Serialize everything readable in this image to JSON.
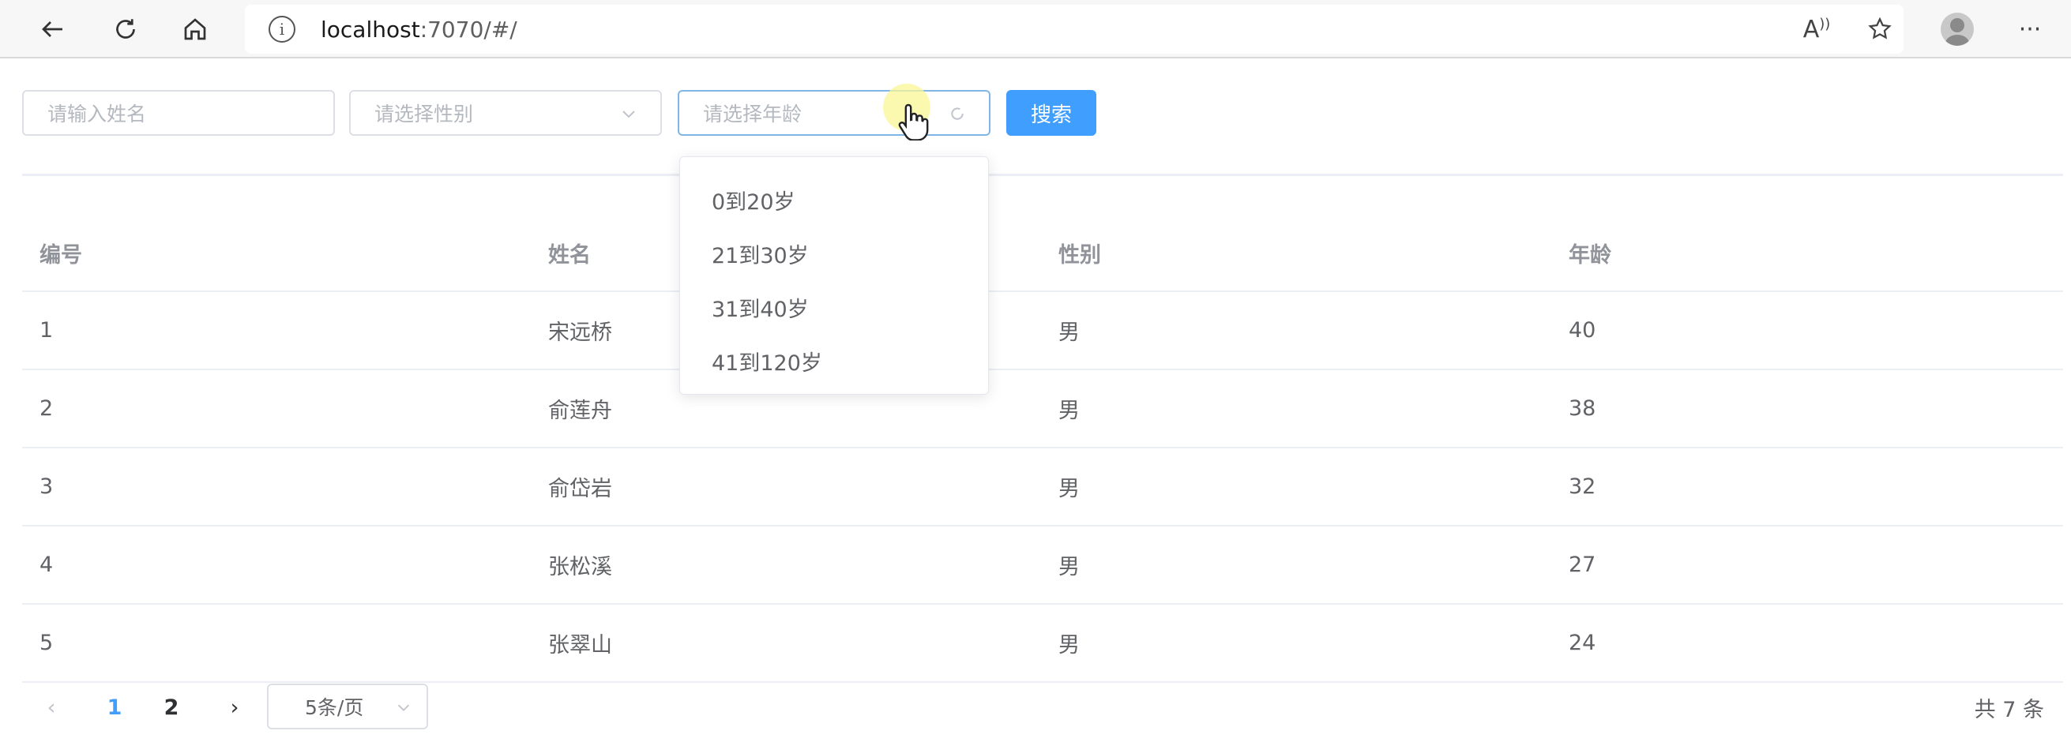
{
  "browser": {
    "url_host": "localhost",
    "url_rest": ":7070/#/",
    "read_aloud_label": "A",
    "more_label": "···"
  },
  "filters": {
    "name_placeholder": "请输入姓名",
    "gender_placeholder": "请选择性别",
    "age_placeholder": "请选择年龄",
    "search_label": "搜索"
  },
  "age_options": [
    "0到20岁",
    "21到30岁",
    "31到40岁",
    "41到120岁"
  ],
  "table": {
    "headers": [
      "编号",
      "姓名",
      "性别",
      "年龄"
    ],
    "rows": [
      [
        "1",
        "宋远桥",
        "男",
        "40"
      ],
      [
        "2",
        "俞莲舟",
        "男",
        "38"
      ],
      [
        "3",
        "俞岱岩",
        "男",
        "32"
      ],
      [
        "4",
        "张松溪",
        "男",
        "27"
      ],
      [
        "5",
        "张翠山",
        "男",
        "24"
      ]
    ]
  },
  "pagination": {
    "prev": "‹",
    "pages": [
      "1",
      "2"
    ],
    "next": "›",
    "page_size": "5条/页",
    "total": "共 7 条"
  },
  "colors": {
    "primary": "#409eff",
    "border": "#dcdfe6",
    "text": "#606266"
  }
}
